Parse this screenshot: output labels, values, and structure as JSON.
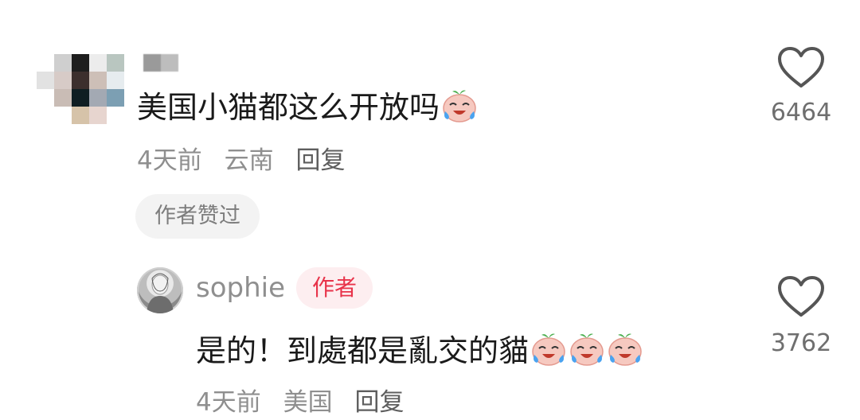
{
  "comment1": {
    "author_name": "",
    "text": "美国小猫都这么开放吗",
    "emoji": "crying-laughing-peach-emoji",
    "time": "4天前",
    "location": "云南",
    "reply_label": "回复",
    "liked_by_author_label": "作者赞过",
    "like_count": "6464"
  },
  "reply1": {
    "author_name": "sophie",
    "author_tag": "作者",
    "text": "是的！到處都是亂交的貓",
    "emoji": "crying-laughing-peach-emoji",
    "emoji_count": 3,
    "time": "4天前",
    "location": "美国",
    "reply_label": "回复",
    "like_count": "3762"
  },
  "icons": {
    "like": "heart-outline-icon"
  },
  "colors": {
    "author_tag_text": "#e8334a",
    "author_tag_bg": "#fdeef0",
    "meta_text": "#8f8f8f"
  }
}
